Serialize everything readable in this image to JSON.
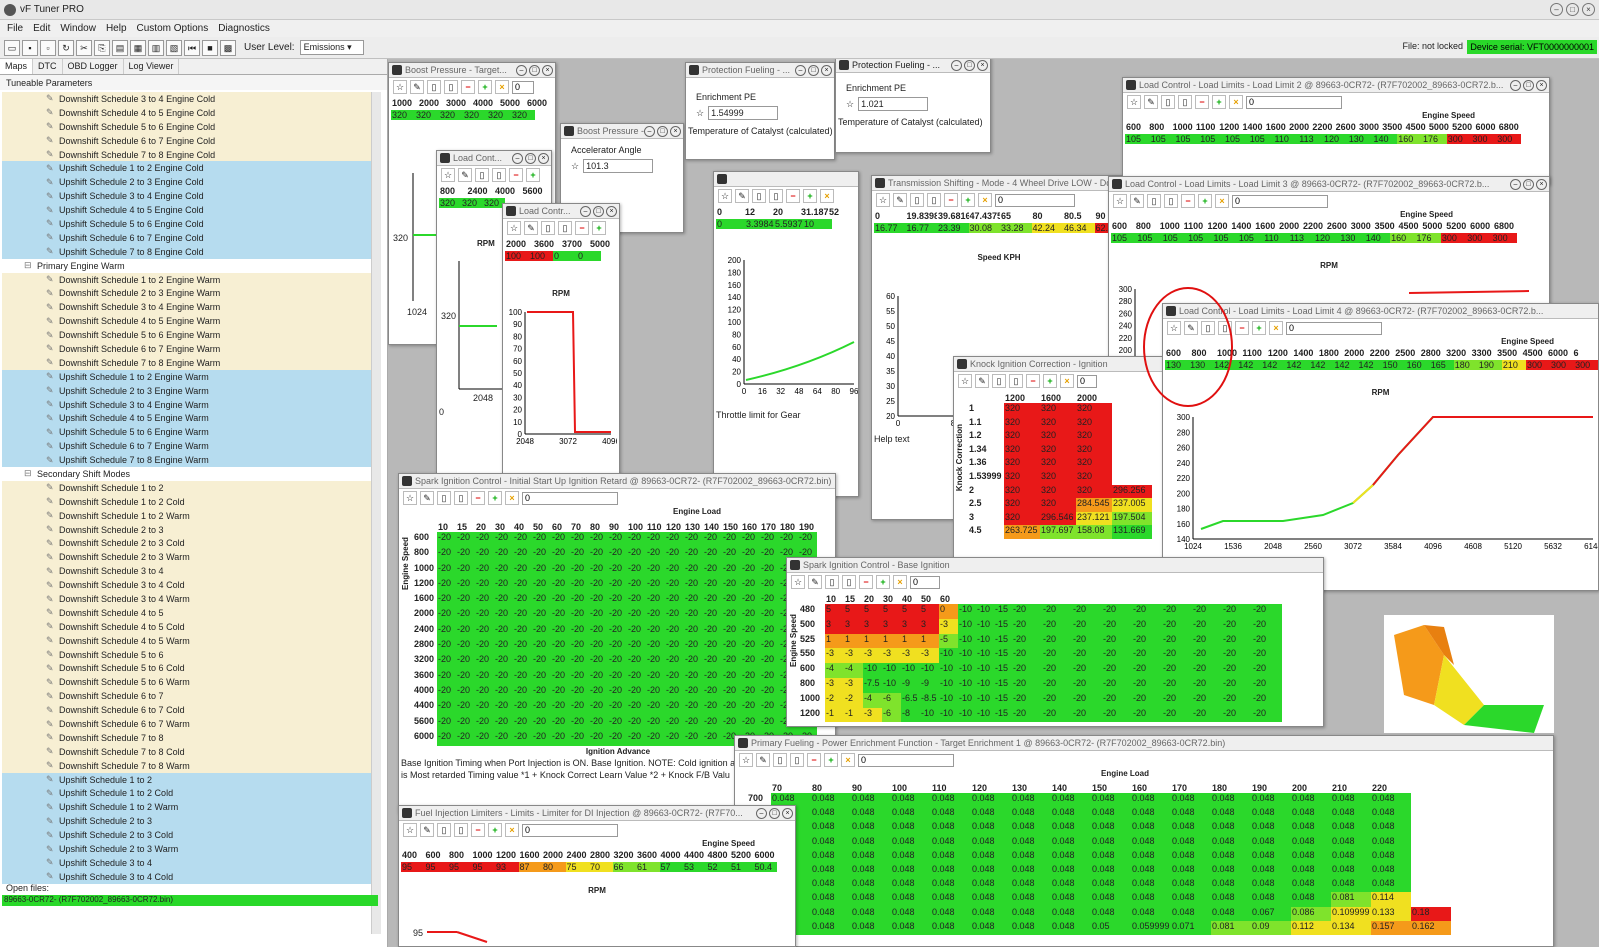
{
  "app": {
    "title": "vF Tuner PRO",
    "menu": [
      "File",
      "Edit",
      "Window",
      "Help",
      "Custom Options",
      "Diagnostics"
    ]
  },
  "toolbar": {
    "user_level_label": "User Level:",
    "user_level": "Emissions",
    "file_state": "File: not locked",
    "serial": "Device serial: VFT0000000001"
  },
  "left": {
    "tabs": [
      "Maps",
      "DTC",
      "OBD Logger",
      "Log Viewer"
    ],
    "section": "Tuneable Parameters",
    "items": [
      {
        "t": "Downshift Schedule 3 to 4 Engine Cold",
        "k": "cold"
      },
      {
        "t": "Downshift Schedule 4 to 5 Engine Cold",
        "k": "cold"
      },
      {
        "t": "Downshift Schedule 5 to 6 Engine Cold",
        "k": "cold"
      },
      {
        "t": "Downshift Schedule 6 to 7 Engine Cold",
        "k": "cold"
      },
      {
        "t": "Downshift Schedule 7 to 8 Engine Cold",
        "k": "cold"
      },
      {
        "t": "Upshift Schedule 1 to 2 Engine Cold",
        "k": "blue"
      },
      {
        "t": "Upshift Schedule 2 to 3 Engine Cold",
        "k": "blue"
      },
      {
        "t": "Upshift Schedule 3 to 4 Engine Cold",
        "k": "blue"
      },
      {
        "t": "Upshift Schedule 4 to 5 Engine Cold",
        "k": "blue"
      },
      {
        "t": "Upshift Schedule 5 to 6 Engine Cold",
        "k": "blue"
      },
      {
        "t": "Upshift Schedule 6 to 7 Engine Cold",
        "k": "blue"
      },
      {
        "t": "Upshift Schedule 7 to 8 Engine Cold",
        "k": "blue"
      },
      {
        "t": "Primary Engine Warm",
        "k": "group"
      },
      {
        "t": "Downshift Schedule 1 to 2 Engine Warm",
        "k": "cold"
      },
      {
        "t": "Downshift Schedule 2 to 3 Engine Warm",
        "k": "cold"
      },
      {
        "t": "Downshift Schedule 3 to 4 Engine Warm",
        "k": "cold"
      },
      {
        "t": "Downshift Schedule 4 to 5 Engine Warm",
        "k": "cold"
      },
      {
        "t": "Downshift Schedule 5 to 6 Engine Warm",
        "k": "cold"
      },
      {
        "t": "Downshift Schedule 6 to 7 Engine Warm",
        "k": "cold"
      },
      {
        "t": "Downshift Schedule 7 to 8 Engine Warm",
        "k": "cold"
      },
      {
        "t": "Upshift Schedule 1 to 2 Engine Warm",
        "k": "blue"
      },
      {
        "t": "Upshift Schedule 2 to 3 Engine Warm",
        "k": "blue"
      },
      {
        "t": "Upshift Schedule 3 to 4 Engine Warm",
        "k": "blue"
      },
      {
        "t": "Upshift Schedule 4 to 5 Engine Warm",
        "k": "blue"
      },
      {
        "t": "Upshift Schedule 5 to 6 Engine Warm",
        "k": "blue"
      },
      {
        "t": "Upshift Schedule 6 to 7 Engine Warm",
        "k": "blue"
      },
      {
        "t": "Upshift Schedule 7 to 8 Engine Warm",
        "k": "blue"
      },
      {
        "t": "Secondary Shift Modes",
        "k": "group"
      },
      {
        "t": "Downshift Schedule 1 to 2",
        "k": "cold"
      },
      {
        "t": "Downshift Schedule 1 to 2 Cold",
        "k": "cold"
      },
      {
        "t": "Downshift Schedule 1 to 2 Warm",
        "k": "cold"
      },
      {
        "t": "Downshift Schedule 2 to 3",
        "k": "cold"
      },
      {
        "t": "Downshift Schedule 2 to 3 Cold",
        "k": "cold"
      },
      {
        "t": "Downshift Schedule 2 to 3 Warm",
        "k": "cold"
      },
      {
        "t": "Downshift Schedule 3 to 4",
        "k": "cold"
      },
      {
        "t": "Downshift Schedule 3 to 4 Cold",
        "k": "cold"
      },
      {
        "t": "Downshift Schedule 3 to 4 Warm",
        "k": "cold"
      },
      {
        "t": "Downshift Schedule 4 to 5",
        "k": "cold"
      },
      {
        "t": "Downshift Schedule 4 to 5 Cold",
        "k": "cold"
      },
      {
        "t": "Downshift Schedule 4 to 5 Warm",
        "k": "cold"
      },
      {
        "t": "Downshift Schedule 5 to 6",
        "k": "cold"
      },
      {
        "t": "Downshift Schedule 5 to 6 Cold",
        "k": "cold"
      },
      {
        "t": "Downshift Schedule 5 to 6 Warm",
        "k": "cold"
      },
      {
        "t": "Downshift Schedule 6 to 7",
        "k": "cold"
      },
      {
        "t": "Downshift Schedule 6 to 7 Cold",
        "k": "cold"
      },
      {
        "t": "Downshift Schedule 6 to 7 Warm",
        "k": "cold"
      },
      {
        "t": "Downshift Schedule 7 to 8",
        "k": "cold"
      },
      {
        "t": "Downshift Schedule 7 to 8 Cold",
        "k": "cold"
      },
      {
        "t": "Downshift Schedule 7 to 8 Warm",
        "k": "cold"
      },
      {
        "t": "Upshift Schedule 1 to 2",
        "k": "blue"
      },
      {
        "t": "Upshift Schedule 1 to 2 Cold",
        "k": "blue"
      },
      {
        "t": "Upshift Schedule 1 to 2 Warm",
        "k": "blue"
      },
      {
        "t": "Upshift Schedule 2 to 3",
        "k": "blue"
      },
      {
        "t": "Upshift Schedule 2 to 3 Cold",
        "k": "blue"
      },
      {
        "t": "Upshift Schedule 2 to 3 Warm",
        "k": "blue"
      },
      {
        "t": "Upshift Schedule 3 to 4",
        "k": "blue"
      },
      {
        "t": "Upshift Schedule 3 to 4 Cold",
        "k": "blue"
      }
    ],
    "open_files_label": "Open files:",
    "open_file": "89663-0CR72- (R7F702002_89663-0CR72.bin)"
  },
  "windows": {
    "boost": {
      "title": "Boost Pressure - Target...",
      "input": "0",
      "cols": [
        "1000",
        "2000",
        "3000",
        "4000",
        "5000",
        "6000"
      ],
      "vals": [
        "320",
        "320",
        "320",
        "320",
        "320",
        "320"
      ],
      "yval": "320",
      "xtick": "1024"
    },
    "boost2": {
      "title": "Boost Pressure - ...",
      "label": "Accelerator Angle",
      "value": "101.3"
    },
    "prot1": {
      "title": "Protection Fueling - ...",
      "label": "Enrichment PE",
      "value": "1.54999",
      "foot": "Temperature of Catalyst (calculated)"
    },
    "prot2": {
      "title": "Protection Fueling - ...",
      "label": "Enrichment PE",
      "value": "1.021",
      "foot": "Temperature of Catalyst (calculated)"
    },
    "loadc": {
      "title": "Load Cont...",
      "cols": [
        "800",
        "2400",
        "4000",
        "5600"
      ],
      "vals": [
        "320",
        "320",
        "320"
      ],
      "axis": "RPM",
      "yval": "320",
      "xtick": "2048",
      "zero": "0"
    },
    "loadc2": {
      "title": "Load Contr...",
      "cols": [
        "2000",
        "3600",
        "3700",
        "5000"
      ],
      "vals": [
        "100",
        "100",
        "0",
        "0"
      ],
      "axis": "RPM",
      "yticks": [
        "100",
        "90",
        "80",
        "70",
        "60",
        "50",
        "40",
        "30",
        "20",
        "10",
        "0"
      ],
      "xticks": [
        "2048",
        "3072",
        "4096"
      ],
      "zero": "0"
    },
    "throttle": {
      "cols": [
        "0",
        "12",
        "20",
        "31.1875",
        "52"
      ],
      "vals": [
        "0",
        "3.39843",
        "5.59375",
        "10"
      ],
      "yticks": [
        "200",
        "180",
        "160",
        "140",
        "120",
        "100",
        "80",
        "60",
        "40",
        "20",
        "0"
      ],
      "xticks": [
        "0",
        "16",
        "32",
        "48",
        "64",
        "80",
        "96"
      ],
      "foot": "Throttle limit for Gear"
    },
    "trans": {
      "title": "Transmission Shifting - Mode - 4 Wheel Drive LOW - Downshift",
      "input": "0",
      "cols": [
        "0",
        "19.8398",
        "39.6816",
        "47.4375",
        "65",
        "80",
        "80.5",
        "90"
      ],
      "vals": [
        "16.77",
        "16.77",
        "23.39",
        "30.08",
        "33.28",
        "42.24",
        "46.34",
        "62.94"
      ],
      "axis": "Speed KPH",
      "yticks": [
        "60",
        "55",
        "50",
        "45",
        "40",
        "35",
        "30",
        "25",
        "20"
      ],
      "xticks": [
        "0",
        "8",
        "16"
      ],
      "foot": "Help text"
    },
    "ll2": {
      "title": "Load Control - Load Limits - Load Limit 2 @ 89663-0CR72- (R7F702002_89663-0CR72.b...",
      "input": "0",
      "axis": "Engine Speed",
      "cols": [
        "600",
        "800",
        "1000",
        "1100",
        "1200",
        "1400",
        "1600",
        "2000",
        "2200",
        "2600",
        "3000",
        "3500",
        "4500",
        "5000",
        "5200",
        "6000",
        "6800"
      ],
      "vals": [
        "105",
        "105",
        "105",
        "105",
        "105",
        "105",
        "110",
        "113",
        "120",
        "130",
        "140",
        "160",
        "176",
        "300",
        "300",
        "300"
      ]
    },
    "ll3": {
      "title": "Load Control - Load Limits - Load Limit 3 @ 89663-0CR72- (R7F702002_89663-0CR72.b...",
      "input": "0",
      "axis": "Engine Speed",
      "cols": [
        "600",
        "800",
        "1000",
        "1100",
        "1200",
        "1400",
        "1600",
        "2000",
        "2200",
        "2600",
        "3000",
        "3500",
        "4500",
        "5000",
        "5200",
        "6000",
        "6800"
      ],
      "vals": [
        "105",
        "105",
        "105",
        "105",
        "105",
        "105",
        "110",
        "113",
        "120",
        "130",
        "140",
        "160",
        "176",
        "300",
        "300",
        "300"
      ],
      "xaxis": "RPM",
      "yticks": [
        "300",
        "280",
        "260",
        "240",
        "220",
        "200",
        "180",
        "160",
        "140",
        "120",
        "100"
      ],
      "zero": "0"
    },
    "ll4": {
      "title": "Load Control - Load Limits - Load Limit 4 @ 89663-0CR72- (R7F702002_89663-0CR72.b...",
      "input": "0",
      "axis": "Engine Speed",
      "cols": [
        "600",
        "800",
        "1000",
        "1100",
        "1200",
        "1400",
        "1800",
        "2000",
        "2200",
        "2500",
        "2800",
        "3200",
        "3300",
        "3500",
        "4500",
        "6000",
        "6"
      ],
      "vals": [
        "130",
        "130",
        "142",
        "142",
        "142",
        "142",
        "142",
        "142",
        "142",
        "150",
        "160",
        "165",
        "180",
        "190",
        "210",
        "300",
        "300",
        "300"
      ],
      "xaxis": "RPM",
      "yticks": [
        "300",
        "280",
        "260",
        "240",
        "220",
        "200",
        "180",
        "160",
        "140"
      ],
      "xticks": [
        "1024",
        "1536",
        "2048",
        "2560",
        "3072",
        "3584",
        "4096",
        "4608",
        "5120",
        "5632",
        "6144"
      ],
      "zero": "0"
    },
    "knock": {
      "title": "Knock Ignition Correction - Ignition",
      "input": "0",
      "cols": [
        "1200",
        "1600",
        "2000"
      ],
      "rows": [
        "1",
        "1.1",
        "1.2",
        "1.34",
        "1.36",
        "1.53999",
        "2",
        "2.5",
        "3",
        "4.5"
      ],
      "ylabel": "Knock Correction",
      "cells": [
        [
          "320",
          "320",
          "320"
        ],
        [
          "320",
          "320",
          "320"
        ],
        [
          "320",
          "320",
          "320"
        ],
        [
          "320",
          "320",
          "320"
        ],
        [
          "320",
          "320",
          "320"
        ],
        [
          "320",
          "320",
          "320"
        ],
        [
          "320",
          "320",
          "320"
        ],
        [
          "320",
          "320",
          "284.545"
        ],
        [
          "320",
          "296.546",
          "237.121"
        ],
        [
          "263.725",
          "197.697",
          "158.08"
        ]
      ],
      "extra": [
        "",
        "",
        "",
        "",
        "",
        "",
        "296.256",
        "237.005",
        "197.504",
        "131.669"
      ]
    },
    "spark1": {
      "title": "Spark Ignition Control - Initial Start Up Ignition Retard @ 89663-0CR72- (R7F702002_89663-0CR72.bin)",
      "input": "0",
      "axis": "Engine Load",
      "ylabel": "Engine Speed",
      "cols": [
        "10",
        "15",
        "20",
        "30",
        "40",
        "50",
        "60",
        "70",
        "80",
        "90",
        "100",
        "110",
        "120",
        "130",
        "140",
        "150",
        "160",
        "170",
        "180",
        "190"
      ],
      "rows": [
        "600",
        "800",
        "1000",
        "1200",
        "1600",
        "2000",
        "2400",
        "2800",
        "3200",
        "3600",
        "4000",
        "4400",
        "5600",
        "6000"
      ],
      "cell": "-20",
      "foot_title": "Ignition Advance",
      "foot": "Base Ignition Timing when Port Injection is ON. Base Ignition. NOTE: Cold ignition a",
      "foot2": "is Most retarded Timing value *1 + Knock Correct Learn Value *2 + Knock F/B Valu"
    },
    "spark2": {
      "title": "Spark Ignition Control - Base Ignition",
      "input": "0",
      "ylabel": "Engine Speed",
      "cols": [
        "10",
        "15",
        "20",
        "30",
        "40",
        "50",
        "60"
      ],
      "rows": [
        "480",
        "500",
        "525",
        "550",
        "600",
        "800",
        "1000",
        "1200"
      ],
      "cells": [
        [
          "5",
          "5",
          "5",
          "5",
          "5",
          "5",
          "0"
        ],
        [
          "3",
          "3",
          "3",
          "3",
          "3",
          "3",
          "-3"
        ],
        [
          "1",
          "1",
          "1",
          "1",
          "1",
          "1",
          "-5"
        ],
        [
          "-3",
          "-3",
          "-3",
          "-3",
          "-3",
          "-3",
          "-10"
        ],
        [
          "-4",
          "-4",
          "-10",
          "-10",
          "-10",
          "-10",
          "-10"
        ],
        [
          "-3",
          "-3",
          "-7.5",
          "-10",
          "-9",
          "-9",
          "-10"
        ],
        [
          "-2",
          "-2",
          "-4",
          "-6",
          "-6.5",
          "-8.5",
          "-10"
        ],
        [
          "-1",
          "-1",
          "-3",
          "-6",
          "-8",
          "-10",
          "-10"
        ]
      ],
      "tail": [
        "-10",
        "-10",
        "-15",
        "-20",
        "-20",
        "-20",
        "-20",
        "-20",
        "-20",
        "-20",
        "-20",
        "-20"
      ]
    },
    "fuel": {
      "title": "Primary Fueling - Power Enrichment Function - Target Enrichment 1 @ 89663-0CR72- (R7F702002_89663-0CR72.bin)",
      "input": "0",
      "axis": "Engine Load",
      "cols": [
        "70",
        "80",
        "90",
        "100",
        "110",
        "120",
        "130",
        "140",
        "150",
        "160",
        "170",
        "180",
        "190",
        "200",
        "210",
        "220"
      ],
      "rows": [
        "700",
        "",
        "",
        "",
        "",
        "",
        "",
        "",
        "",
        "",
        ""
      ],
      "cells": [
        [
          "0.048",
          "0.048",
          "0.048",
          "0.048",
          "0.048",
          "0.048",
          "0.048",
          "0.048",
          "0.048",
          "0.048",
          "0.048",
          "0.048",
          "0.048",
          "0.048",
          "0.048",
          "0.048"
        ],
        [
          "0.048",
          "0.048",
          "0.048",
          "0.048",
          "0.048",
          "0.048",
          "0.048",
          "0.048",
          "0.048",
          "0.048",
          "0.048",
          "0.048",
          "0.048",
          "0.048",
          "0.048",
          "0.048"
        ],
        [
          "0.048",
          "0.048",
          "0.048",
          "0.048",
          "0.048",
          "0.048",
          "0.048",
          "0.048",
          "0.048",
          "0.048",
          "0.048",
          "0.048",
          "0.048",
          "0.048",
          "0.048",
          "0.048"
        ],
        [
          "0.048",
          "0.048",
          "0.048",
          "0.048",
          "0.048",
          "0.048",
          "0.048",
          "0.048",
          "0.048",
          "0.048",
          "0.048",
          "0.048",
          "0.048",
          "0.048",
          "0.048",
          "0.048"
        ],
        [
          "0.048",
          "0.048",
          "0.048",
          "0.048",
          "0.048",
          "0.048",
          "0.048",
          "0.048",
          "0.048",
          "0.048",
          "0.048",
          "0.048",
          "0.048",
          "0.048",
          "0.048",
          "0.048"
        ],
        [
          "0.048",
          "0.048",
          "0.048",
          "0.048",
          "0.048",
          "0.048",
          "0.048",
          "0.048",
          "0.048",
          "0.048",
          "0.048",
          "0.048",
          "0.048",
          "0.048",
          "0.048",
          "0.048"
        ],
        [
          "0.048",
          "0.048",
          "0.048",
          "0.048",
          "0.048",
          "0.048",
          "0.048",
          "0.048",
          "0.048",
          "0.048",
          "0.048",
          "0.048",
          "0.048",
          "0.048",
          "0.048",
          "0.048"
        ],
        [
          "0.048",
          "0.048",
          "0.048",
          "0.048",
          "0.048",
          "0.048",
          "0.048",
          "0.048",
          "0.048",
          "0.048",
          "0.048",
          "0.048",
          "0.048",
          "0.048",
          "0.081",
          "0.114"
        ],
        [
          "0.048",
          "0.048",
          "0.048",
          "0.048",
          "0.048",
          "0.048",
          "0.048",
          "0.048",
          "0.048",
          "0.048",
          "0.048",
          "0.048",
          "0.067",
          "0.086",
          "0.109999",
          "0.133",
          "0.18"
        ],
        [
          "0.048",
          "0.048",
          "0.048",
          "0.048",
          "0.048",
          "0.048",
          "0.048",
          "0.048",
          "0.05",
          "0.059999",
          "0.071",
          "0.081",
          "0.09",
          "0.112",
          "0.134",
          "0.157",
          "0.162"
        ]
      ]
    },
    "inj": {
      "title": "Fuel Injection Limiters - Limits - Limiter for DI Injection @ 89663-0CR72- (R7F70...",
      "input": "0",
      "axis": "Engine Speed",
      "cols": [
        "400",
        "600",
        "800",
        "1000",
        "1200",
        "1600",
        "2000",
        "2400",
        "2800",
        "3200",
        "3600",
        "4000",
        "4400",
        "4800",
        "5200",
        "6000"
      ],
      "vals": [
        "95",
        "95",
        "95",
        "95",
        "93",
        "87",
        "80",
        "75",
        "70",
        "66",
        "61",
        "57",
        "53",
        "52",
        "51",
        "50.4"
      ],
      "xaxis": "RPM",
      "ytick": "95"
    }
  }
}
